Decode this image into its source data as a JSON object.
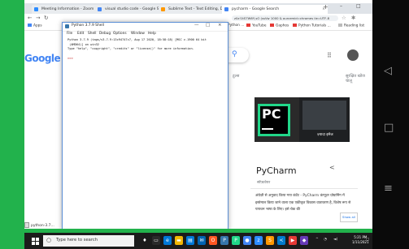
{
  "browser": {
    "tabs": [
      {
        "label": "Meeting Information - Zoom",
        "color": "#2d8cff"
      },
      {
        "label": "visual studio code - Google Sea",
        "color": "#4285f4"
      },
      {
        "label": "Sublime Text - Text Editing, Do",
        "color": "#ff9800"
      },
      {
        "label": "pycharm - Google Search",
        "color": "#4285f4"
      }
    ],
    "new_tab": "+",
    "address": "z0z!1tS7W6Y,sO (ssVw 1000 & ourcemid=chromes iie=UTF-8",
    "bookmarks": [
      "Apps",
      "Python ...",
      "YouTube",
      "Gaphos",
      "Python Tutorials ...",
      "Reading list"
    ]
  },
  "google": {
    "logo": "Google",
    "shifts": "टूल्स",
    "tools": "सुरक्षित खोज चालू"
  },
  "knowledge_panel": {
    "title": "PyCharm",
    "subtitle": "सॉफ़्टवेयर",
    "image_caption": "ज़्यादा इमेज",
    "description": "अंग्रेज़ी से अनुवाद किया गया कंटेंट - PyCharm कंप्यूटर प्रोग्रामिंग में इस्तेमाल किया जाने वाला एक एकीकृत विकास वातावरण है, विशेष रूप से पायथन भाषा के लिए। इसे चेक की",
    "show_all": "Show all"
  },
  "idle": {
    "title": "Python 3.7.9 Shell",
    "controls": [
      "—",
      "□",
      "×"
    ],
    "menu": [
      "File",
      "Edit",
      "Shell",
      "Debug",
      "Options",
      "Window",
      "Help"
    ],
    "output": [
      "Python 3.7.9 (tags/v3.7.9:13c94747c7, Aug 17 2020, 18:58:18) [MSC v.1900 64 bit",
      " (AMD64)] on win32",
      "Type \"help\", \"copyright\", \"credits\" or \"license()\" for more information."
    ],
    "prompt": ">>>"
  },
  "downloads": {
    "file": "python-3.7..."
  },
  "taskbar": {
    "search_placeholder": "Type here to search",
    "time": "5:21 PM",
    "date": "1/11/2021"
  },
  "colors": {
    "frame_green": "#22b24c",
    "idle_border": "#5b8fd6"
  }
}
